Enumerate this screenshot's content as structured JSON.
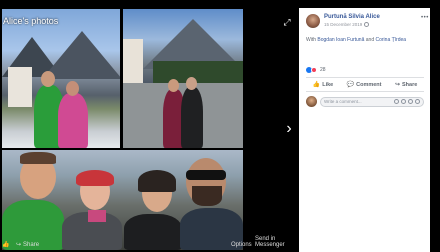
{
  "viewer": {
    "album_title": "Alice's photos",
    "bottom": {
      "like_label": "Like",
      "share_label": "Share",
      "options_label": "Options",
      "messenger_label": "Send in Messenger"
    }
  },
  "panel": {
    "author_name": "Purtună Silvia Alice",
    "post_date": "15 December 2019",
    "with_prefix": "With",
    "tag1": "Bogdan Ioan Furtună",
    "with_and": "and",
    "tag2": "Corina Țîrdea",
    "reaction_count": "28",
    "actions": {
      "like": "Like",
      "comment": "Comment",
      "share": "Share"
    },
    "comment_placeholder": "Write a comment..."
  }
}
